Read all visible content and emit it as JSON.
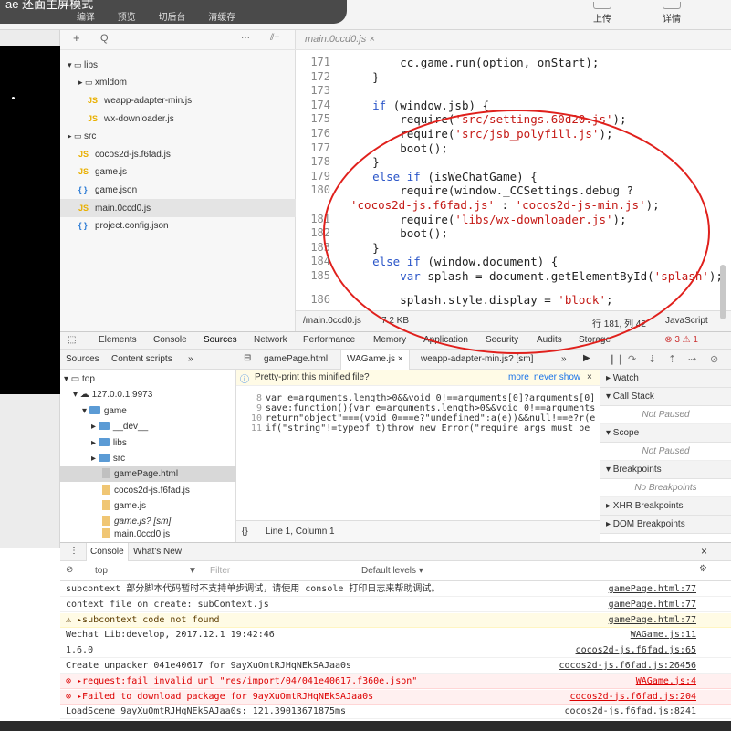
{
  "toolbar": {
    "popup_text": "ae 还面主屏模式",
    "buttons": [
      "编译",
      "预览",
      "切后台",
      "清缓存"
    ],
    "upload": "上传",
    "details": "详情"
  },
  "file_tree": {
    "header_add": "+",
    "header_search": "Q",
    "header_more": "···",
    "header_split": "⫽+",
    "items": [
      {
        "label": "libs",
        "icon": "folder-open-icon"
      },
      {
        "label": "xmldom",
        "icon": "folder-icon"
      },
      {
        "label": "weapp-adapter-min.js",
        "icon": "JS"
      },
      {
        "label": "wx-downloader.js",
        "icon": "JS"
      },
      {
        "label": "src",
        "icon": "folder-icon"
      },
      {
        "label": "cocos2d-js.f6fad.js",
        "icon": "JS"
      },
      {
        "label": "game.js",
        "icon": "JS"
      },
      {
        "label": "game.json",
        "icon": "{ }"
      },
      {
        "label": "main.0ccd0.js",
        "icon": "JS"
      },
      {
        "label": "project.config.json",
        "icon": "{ }"
      }
    ]
  },
  "editor": {
    "tab": "main.0ccd0.js",
    "lines": [
      {
        "n": "171",
        "code": "        cc.game.run(option, onStart);"
      },
      {
        "n": "172",
        "code": "    }"
      },
      {
        "n": "173",
        "code": ""
      },
      {
        "n": "174",
        "code": "    if (window.jsb) {"
      },
      {
        "n": "175",
        "code": "        require('src/settings.60d20.js');"
      },
      {
        "n": "176",
        "code": "        require('src/jsb_polyfill.js');"
      },
      {
        "n": "177",
        "code": "        boot();"
      },
      {
        "n": "178",
        "code": "    }"
      },
      {
        "n": "179",
        "code": "    else if (isWeChatGame) {"
      },
      {
        "n": "180",
        "code": "        require(window._CCSettings.debug ?"
      },
      {
        "n": "",
        "code": "'cocos2d-js.f6fad.js' : 'cocos2d-js-min.js');"
      },
      {
        "n": "181",
        "code": "        require('libs/wx-downloader.js');"
      },
      {
        "n": "182",
        "code": "        boot();"
      },
      {
        "n": "183",
        "code": "    }"
      },
      {
        "n": "184",
        "code": "    else if (window.document) {"
      },
      {
        "n": "185",
        "code": "        var splash = document.getElementById('splash');"
      },
      {
        "n": "186",
        "code": "        splash.style.display = 'block';"
      }
    ],
    "status_path": "/main.0ccd0.js",
    "status_size": "7.2 KB",
    "status_pos": "行 181, 列 42",
    "status_lang": "JavaScript"
  },
  "devtools": {
    "tabs": [
      "Elements",
      "Console",
      "Sources",
      "Network",
      "Performance",
      "Memory",
      "Application",
      "Security",
      "Audits",
      "Storage"
    ],
    "active_tab": "Sources",
    "counts": "⊗ 3  ⚠ 1",
    "sources_tabs": [
      "Sources",
      "Content scripts",
      "»"
    ],
    "source_tree": [
      {
        "label": "top",
        "kind": "frame"
      },
      {
        "label": "127.0.0.1:9973",
        "kind": "cloud"
      },
      {
        "label": "game",
        "kind": "folder"
      },
      {
        "label": "__dev__",
        "kind": "folder"
      },
      {
        "label": "libs",
        "kind": "folder"
      },
      {
        "label": "src",
        "kind": "folder"
      },
      {
        "label": "gamePage.html",
        "kind": "html"
      },
      {
        "label": "cocos2d-js.f6fad.js",
        "kind": "js"
      },
      {
        "label": "game.js",
        "kind": "js"
      },
      {
        "label": "game.js? [sm]",
        "kind": "js"
      },
      {
        "label": "main.0ccd0.js",
        "kind": "js"
      }
    ],
    "editor_tabs": [
      "gamePage.html",
      "WAGame.js ×",
      "weapp-adapter-min.js? [sm]",
      "»"
    ],
    "pretty_print": "Pretty-print this minified file?",
    "pp_more": "more",
    "pp_never": "never show",
    "minified_lines": [
      {
        "n": "8",
        "code": "var e=arguments.length>0&&void 0!==arguments[0]?arguments[0]"
      },
      {
        "n": "9",
        "code": "save:function(){var e=arguments.length>0&&void 0!==arguments"
      },
      {
        "n": "10",
        "code": "return\"object\"===(void 0===e?\"undefined\":a(e))&&null!==e?r(e"
      },
      {
        "n": "11",
        "code": "if(\"string\"!=typeof t)throw new Error(\"require args must be"
      }
    ],
    "mid_status": "Line 1, Column 1",
    "debugger_sections": [
      {
        "title": "▸ Watch",
        "empty": ""
      },
      {
        "title": "▾ Call Stack",
        "empty": "Not Paused"
      },
      {
        "title": "▾ Scope",
        "empty": "Not Paused"
      },
      {
        "title": "▾ Breakpoints",
        "empty": "No Breakpoints"
      },
      {
        "title": "▸ XHR Breakpoints",
        "empty": ""
      },
      {
        "title": "▸ DOM Breakpoints",
        "empty": ""
      }
    ]
  },
  "console": {
    "tabs": [
      "Console",
      "What's New"
    ],
    "context": "top",
    "filter_placeholder": "Filter",
    "levels": "Default levels ▾",
    "rows": [
      {
        "type": "log",
        "msg": "    subcontext 部分脚本代码暂时不支持单步调试，请使用 console 打印日志来帮助调试。",
        "src": "gamePage.html:77"
      },
      {
        "type": "log",
        "msg": "    context file on create:  subContext.js",
        "src": "gamePage.html:77"
      },
      {
        "type": "warn",
        "msg": "⚠ ▸subcontext code not found",
        "src": "gamePage.html:77"
      },
      {
        "type": "log",
        "msg": "    Wechat Lib:develop, 2017.12.1 19:42:46",
        "src": "WAGame.js:11"
      },
      {
        "type": "log",
        "msg": "    1.6.0",
        "src": "cocos2d-js.f6fad.js:65"
      },
      {
        "type": "log",
        "msg": "    Create unpacker 041e40617 for 9ayXuOmtRJHqNEkSAJaa0s",
        "src": "cocos2d-js.f6fad.js:26456"
      },
      {
        "type": "err",
        "msg": "⊗ ▸request:fail invalid url \"res/import/04/041e40617.f360e.json\"",
        "src": "WAGame.js:4"
      },
      {
        "type": "err",
        "msg": "⊗ ▸Failed to download package for 9ayXuOmtRJHqNEkSAJaa0s",
        "src": "cocos2d-js.f6fad.js:204"
      },
      {
        "type": "log",
        "msg": "    LoadScene 9ayXuOmtRJHqNEkSAJaa0s: 121.39013671875ms",
        "src": "cocos2d-js.f6fad.js:8241"
      }
    ]
  },
  "colors": {
    "annotation_circle": "#e0201c",
    "keyword": "#2a55c8",
    "string": "#c41a16",
    "js_icon": "#e9b000",
    "json_icon": "#2a7ad4"
  }
}
